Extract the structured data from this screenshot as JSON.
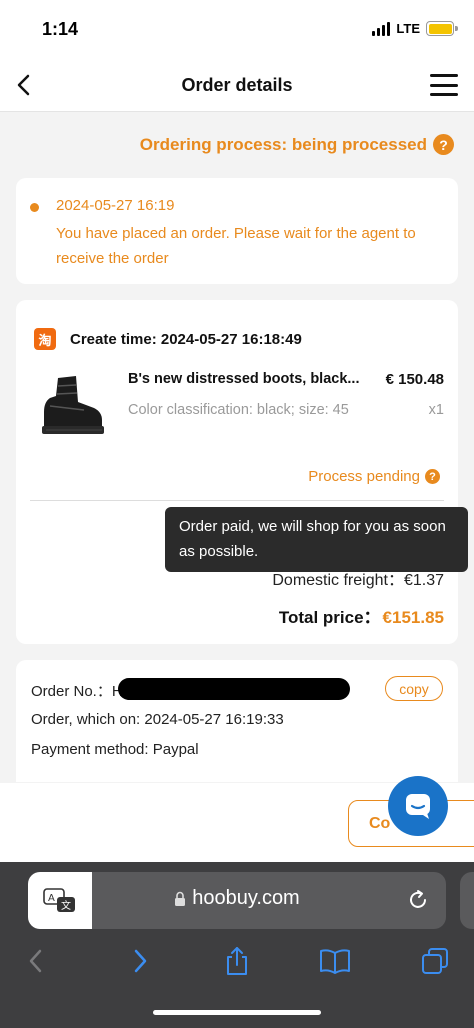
{
  "status_bar": {
    "time": "1:14",
    "network": "LTE"
  },
  "header": {
    "title": "Order details"
  },
  "process_status": {
    "label": "Ordering process: being processed",
    "help_icon": "?"
  },
  "timeline": {
    "time": "2024-05-27 16:19",
    "message": "You have placed an order. Please wait for the agent to receive the order"
  },
  "order": {
    "store_icon": "淘",
    "create_time": "Create time: 2024-05-27 16:18:49",
    "product": {
      "name": "B's new distressed boots, black...",
      "price": "€ 150.48",
      "spec": "Color classification: black; size: 45",
      "quantity": "x1"
    },
    "process_label": "Process pending",
    "freight": "Domestic freight：€1.37",
    "total_label": "Total price：",
    "total_value": "€151.85"
  },
  "tooltip": {
    "text": "Order paid, we will shop for you as soon as possible."
  },
  "info": {
    "order_no_label": "Order No.：H",
    "copy_label": "copy",
    "order_on": "Order, which on: 2024-05-27 16:19:33",
    "payment": "Payment method: Paypal"
  },
  "actions": {
    "contact_label": "Co"
  },
  "browser": {
    "url": "hoobuy.com"
  },
  "colors": {
    "accent": "#e88a1e",
    "chat": "#1a73c8",
    "browser_bg": "#3e3e40"
  }
}
